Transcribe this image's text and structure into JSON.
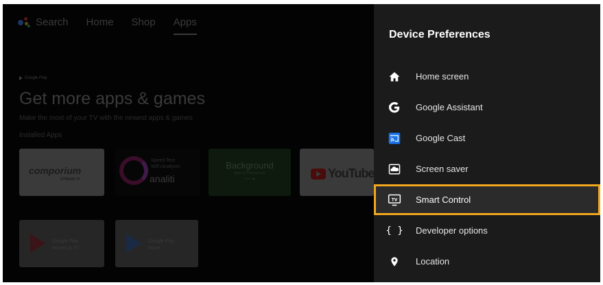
{
  "top_nav": {
    "items": [
      "Search",
      "Home",
      "Shop",
      "Apps"
    ],
    "active": "Apps"
  },
  "home": {
    "brand_small": "Google Play",
    "title": "Get more apps & games",
    "subtitle": "Make the most of your TV with the newest apps & games",
    "section_label": "Installed Apps"
  },
  "apps_row1": [
    {
      "name": "comporium",
      "sub": "STREAM TV"
    },
    {
      "lines": [
        "Speed Test",
        "WiFi Analyzer"
      ],
      "brand": "analiti"
    },
    {
      "title": "Background",
      "sub": "Apps & Process List",
      "dots": "• • • ♥"
    },
    {
      "name": "YouTube"
    }
  ],
  "apps_row2": [
    {
      "lines": [
        "Google Play",
        "Movies & TV"
      ]
    },
    {
      "lines": [
        "Google Play",
        "Store"
      ]
    }
  ],
  "panel": {
    "title": "Device Preferences",
    "items": [
      {
        "label": "Home screen",
        "icon": "home-icon"
      },
      {
        "label": "Google Assistant",
        "icon": "google-g-icon"
      },
      {
        "label": "Google Cast",
        "icon": "cast-icon"
      },
      {
        "label": "Screen saver",
        "icon": "screen-saver-icon"
      },
      {
        "label": "Smart Control",
        "icon": "tv-icon"
      },
      {
        "label": "Developer options",
        "icon": "braces-icon"
      },
      {
        "label": "Location",
        "icon": "location-pin-icon"
      }
    ],
    "focused_item": "Smart Control",
    "focus_color": "#f2a71d",
    "cast_icon_color": "#1a73e8"
  }
}
